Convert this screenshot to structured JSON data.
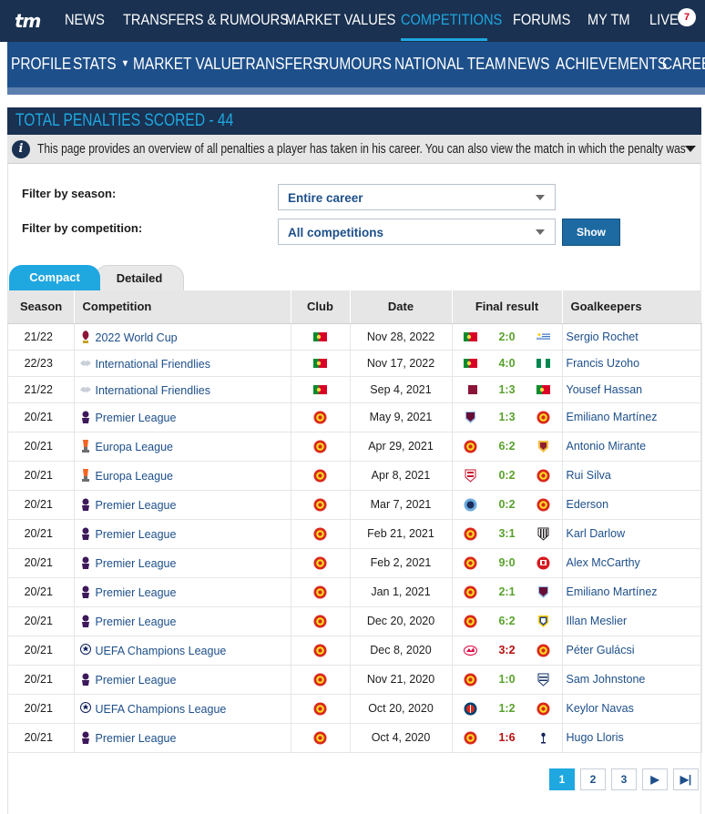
{
  "top_nav": {
    "logo": "tm",
    "items": [
      "NEWS",
      "TRANSFERS & RUMOURS",
      "MARKET VALUES",
      "COMPETITIONS",
      "FORUMS",
      "MY TM",
      "LIVE"
    ],
    "live_badge": "7"
  },
  "sub_nav": {
    "items": [
      "PROFILE",
      "STATS",
      "MARKET VALUE",
      "TRANSFERS",
      "RUMOURS",
      "NATIONAL TEAM",
      "NEWS",
      "ACHIEVEMENTS",
      "CAREER"
    ]
  },
  "box": {
    "title": "TOTAL PENALTIES SCORED - 44",
    "info": "This page provides an overview of all penalties a player has taken in his career. You can also view the match in which the penalty was awarde..."
  },
  "filters": {
    "season_label": "Filter by season:",
    "season_value": "Entire career",
    "competition_label": "Filter by competition:",
    "competition_value": "All competitions",
    "show_button": "Show"
  },
  "tabs": [
    "Compact",
    "Detailed"
  ],
  "table": {
    "headers": [
      "Season",
      "Competition",
      "Club",
      "Date",
      "Final result",
      "Goalkeepers"
    ],
    "rows": [
      {
        "season": "21/22",
        "competition": "2022 World Cup",
        "comp_icon": "world-cup-icon",
        "club": "portugal-flag",
        "date": "Nov 28, 2022",
        "home": "portugal-flag",
        "score": "2:0",
        "outcome": "win",
        "away": "uruguay-flag",
        "goalkeeper": "Sergio Rochet"
      },
      {
        "season": "22/23",
        "competition": "International Friendlies",
        "comp_icon": "friendlies-icon",
        "club": "portugal-flag",
        "date": "Nov 17, 2022",
        "home": "portugal-flag",
        "score": "4:0",
        "outcome": "win",
        "away": "nigeria-flag",
        "goalkeeper": "Francis Uzoho"
      },
      {
        "season": "21/22",
        "competition": "International Friendlies",
        "comp_icon": "friendlies-icon",
        "club": "portugal-flag",
        "date": "Sep 4, 2021",
        "home": "qatar-flag",
        "score": "1:3",
        "outcome": "win",
        "away": "portugal-flag",
        "goalkeeper": "Yousef Hassan"
      },
      {
        "season": "20/21",
        "competition": "Premier League",
        "comp_icon": "premier-league-icon",
        "club": "man-utd-crest",
        "date": "May 9, 2021",
        "home": "aston-villa-crest",
        "score": "1:3",
        "outcome": "win",
        "away": "man-utd-crest",
        "goalkeeper": "Emiliano Martínez"
      },
      {
        "season": "20/21",
        "competition": "Europa League",
        "comp_icon": "europa-league-icon",
        "club": "man-utd-crest",
        "date": "Apr 29, 2021",
        "home": "man-utd-crest",
        "score": "6:2",
        "outcome": "win",
        "away": "roma-crest",
        "goalkeeper": "Antonio Mirante"
      },
      {
        "season": "20/21",
        "competition": "Europa League",
        "comp_icon": "europa-league-icon",
        "club": "man-utd-crest",
        "date": "Apr 8, 2021",
        "home": "granada-crest",
        "score": "0:2",
        "outcome": "win",
        "away": "man-utd-crest",
        "goalkeeper": "Rui Silva"
      },
      {
        "season": "20/21",
        "competition": "Premier League",
        "comp_icon": "premier-league-icon",
        "club": "man-utd-crest",
        "date": "Mar 7, 2021",
        "home": "man-city-crest",
        "score": "0:2",
        "outcome": "win",
        "away": "man-utd-crest",
        "goalkeeper": "Ederson"
      },
      {
        "season": "20/21",
        "competition": "Premier League",
        "comp_icon": "premier-league-icon",
        "club": "man-utd-crest",
        "date": "Feb 21, 2021",
        "home": "man-utd-crest",
        "score": "3:1",
        "outcome": "win",
        "away": "newcastle-crest",
        "goalkeeper": "Karl Darlow"
      },
      {
        "season": "20/21",
        "competition": "Premier League",
        "comp_icon": "premier-league-icon",
        "club": "man-utd-crest",
        "date": "Feb 2, 2021",
        "home": "man-utd-crest",
        "score": "9:0",
        "outcome": "win",
        "away": "southampton-crest",
        "goalkeeper": "Alex McCarthy"
      },
      {
        "season": "20/21",
        "competition": "Premier League",
        "comp_icon": "premier-league-icon",
        "club": "man-utd-crest",
        "date": "Jan 1, 2021",
        "home": "man-utd-crest",
        "score": "2:1",
        "outcome": "win",
        "away": "aston-villa-crest",
        "goalkeeper": "Emiliano Martínez"
      },
      {
        "season": "20/21",
        "competition": "Premier League",
        "comp_icon": "premier-league-icon",
        "club": "man-utd-crest",
        "date": "Dec 20, 2020",
        "home": "man-utd-crest",
        "score": "6:2",
        "outcome": "win",
        "away": "leeds-crest",
        "goalkeeper": "Illan Meslier"
      },
      {
        "season": "20/21",
        "competition": "UEFA Champions League",
        "comp_icon": "champions-league-icon",
        "club": "man-utd-crest",
        "date": "Dec 8, 2020",
        "home": "leipzig-crest",
        "score": "3:2",
        "outcome": "loss",
        "away": "man-utd-crest",
        "goalkeeper": "Péter Gulácsi"
      },
      {
        "season": "20/21",
        "competition": "Premier League",
        "comp_icon": "premier-league-icon",
        "club": "man-utd-crest",
        "date": "Nov 21, 2020",
        "home": "man-utd-crest",
        "score": "1:0",
        "outcome": "win",
        "away": "west-brom-crest",
        "goalkeeper": "Sam Johnstone"
      },
      {
        "season": "20/21",
        "competition": "UEFA Champions League",
        "comp_icon": "champions-league-icon",
        "club": "man-utd-crest",
        "date": "Oct 20, 2020",
        "home": "psg-crest",
        "score": "1:2",
        "outcome": "win",
        "away": "man-utd-crest",
        "goalkeeper": "Keylor Navas"
      },
      {
        "season": "20/21",
        "competition": "Premier League",
        "comp_icon": "premier-league-icon",
        "club": "man-utd-crest",
        "date": "Oct 4, 2020",
        "home": "man-utd-crest",
        "score": "1:6",
        "outcome": "loss",
        "away": "tottenham-crest",
        "goalkeeper": "Hugo Lloris"
      }
    ]
  },
  "pagination": {
    "pages": [
      "1",
      "2",
      "3"
    ],
    "current": "1",
    "next_icon": "next-page-icon",
    "last_icon": "last-page-icon"
  },
  "colors": {
    "navy": "#1a3151",
    "sub_nav": "#1d4f8a",
    "accent": "#1fa7e0",
    "link": "#1d4f8a",
    "win": "#58a12b",
    "loss": "#b50d0d"
  }
}
